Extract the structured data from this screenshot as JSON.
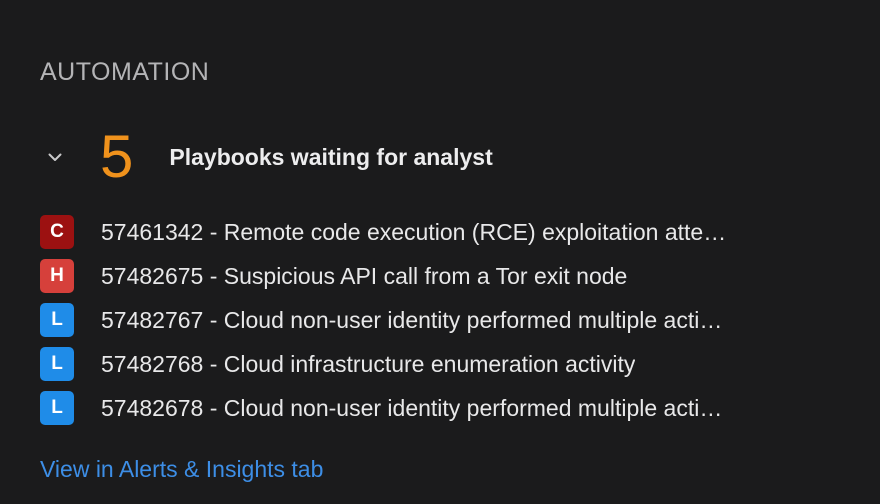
{
  "section": {
    "title": "AUTOMATION"
  },
  "group": {
    "count": "5",
    "label": "Playbooks waiting for analyst",
    "icon": "chevron-down-icon"
  },
  "colors": {
    "count": "#f0921c",
    "critical": "#9c1111",
    "high": "#d6403b",
    "low": "#1f8ce8",
    "link": "#3d8ee6"
  },
  "alerts": [
    {
      "severity": "C",
      "severity_level": "critical",
      "text": "57461342 - Remote code execution (RCE) exploitation atte…"
    },
    {
      "severity": "H",
      "severity_level": "high",
      "text": "57482675 - Suspicious API call from a Tor exit node"
    },
    {
      "severity": "L",
      "severity_level": "low",
      "text": "57482767 - Cloud non-user identity performed multiple acti…"
    },
    {
      "severity": "L",
      "severity_level": "low",
      "text": "57482768 - Cloud infrastructure enumeration activity"
    },
    {
      "severity": "L",
      "severity_level": "low",
      "text": "57482678 - Cloud non-user identity performed multiple acti…"
    }
  ],
  "footer": {
    "link_label": "View in Alerts & Insights tab"
  }
}
